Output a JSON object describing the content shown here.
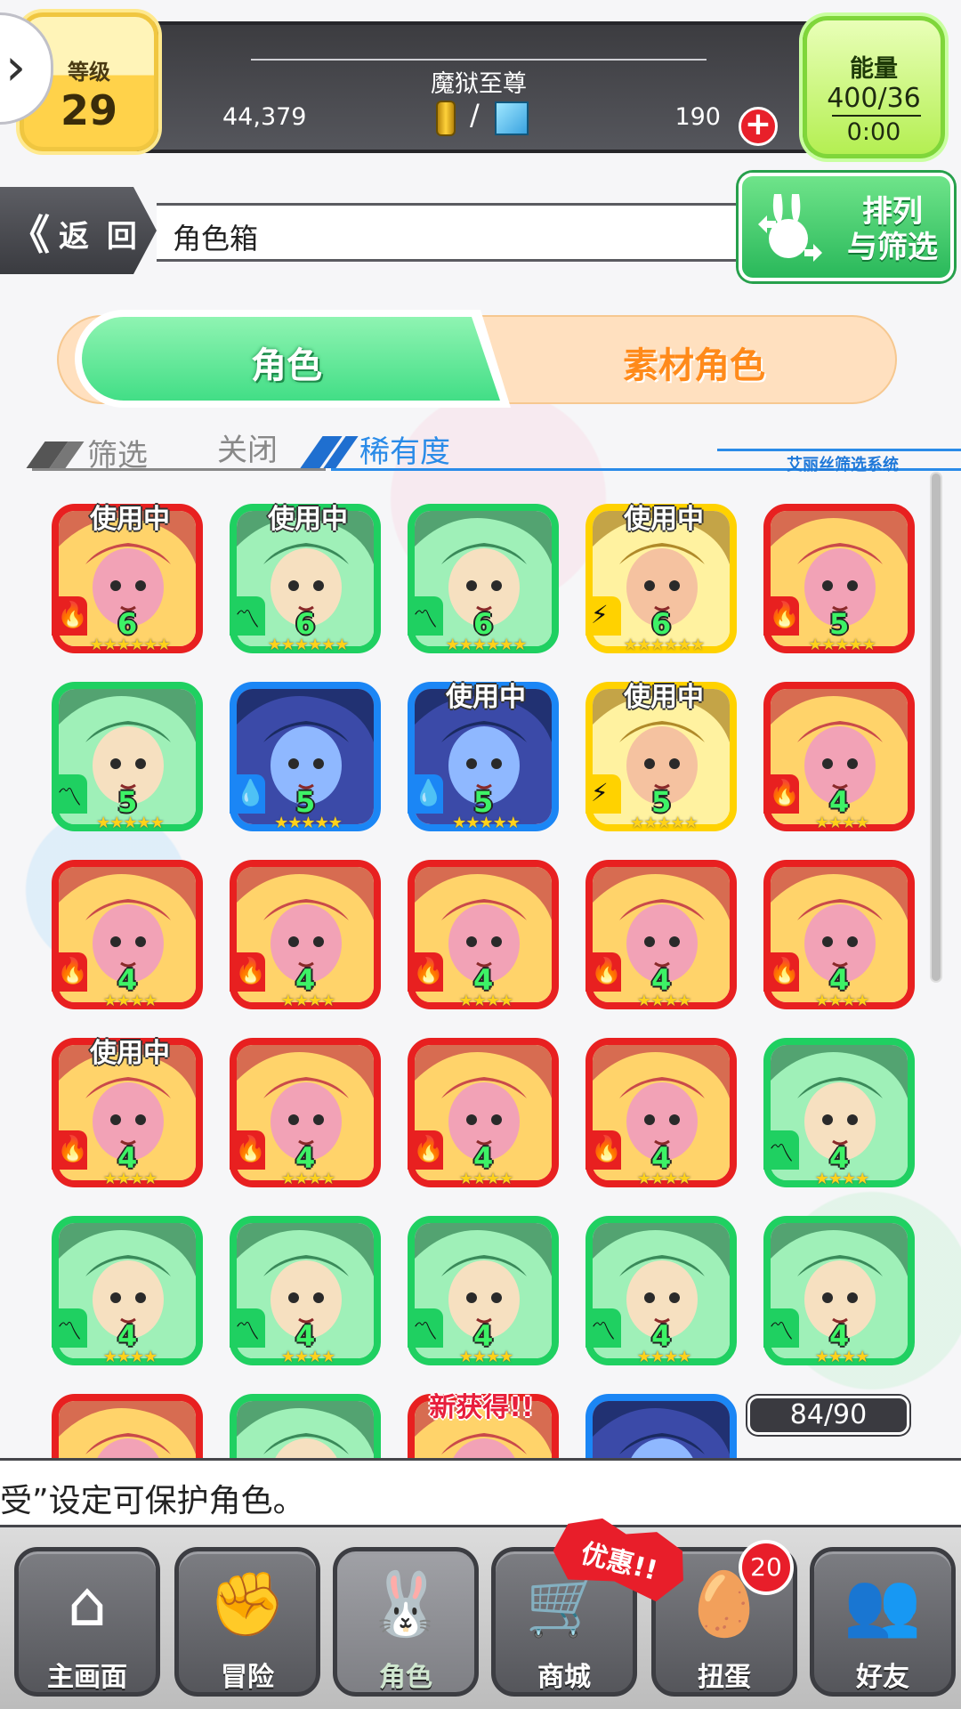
{
  "status_bar": {
    "level_label": "等级",
    "level_value": "29",
    "player_title": "魔狱至尊",
    "coins": "44,379",
    "crystals": "190",
    "currency_separator": "/",
    "plus_label": "+",
    "energy_label": "能量",
    "energy_value": "400/36",
    "energy_timer": "0:00"
  },
  "nav": {
    "back_label": "返 回",
    "back_chevron": "《",
    "breadcrumb": "角色箱",
    "sort_label_line1": "排列",
    "sort_label_line2": "与筛选"
  },
  "tabs": {
    "characters": "角色",
    "materials": "素材角色"
  },
  "filter": {
    "filter_label": "筛选",
    "filter_state": "关闭",
    "rarity_label": "稀有度",
    "system_label": "艾丽丝筛选系统"
  },
  "card_text": {
    "in_use": "使用中",
    "new_badge": "新获得!!",
    "stars_6": "★★★★★★",
    "stars_5": "★★★★★",
    "stars_4": "★★★★"
  },
  "element_icons": {
    "fire": "🔥",
    "wind": "〽",
    "water": "💧",
    "thunder": "⚡"
  },
  "colors": {
    "fire": "#e82020",
    "wind": "#1fd061",
    "water": "#1b86f5",
    "thunder": "#ffd200",
    "accent_green": "#42de86",
    "accent_orange": "#ff8a1a"
  },
  "characters": [
    {
      "element": "fire",
      "count": "6",
      "in_use": true
    },
    {
      "element": "wind",
      "count": "6",
      "in_use": true
    },
    {
      "element": "wind",
      "count": "6",
      "in_use": false
    },
    {
      "element": "thunder",
      "count": "6",
      "in_use": true
    },
    {
      "element": "fire",
      "count": "5",
      "in_use": false
    },
    {
      "element": "wind",
      "count": "5",
      "in_use": false
    },
    {
      "element": "water",
      "count": "5",
      "in_use": false
    },
    {
      "element": "water",
      "count": "5",
      "in_use": true
    },
    {
      "element": "thunder",
      "count": "5",
      "in_use": true
    },
    {
      "element": "fire",
      "count": "4",
      "in_use": false
    },
    {
      "element": "fire",
      "count": "4",
      "in_use": false
    },
    {
      "element": "fire",
      "count": "4",
      "in_use": false
    },
    {
      "element": "fire",
      "count": "4",
      "in_use": false
    },
    {
      "element": "fire",
      "count": "4",
      "in_use": false
    },
    {
      "element": "fire",
      "count": "4",
      "in_use": false
    },
    {
      "element": "fire",
      "count": "4",
      "in_use": true
    },
    {
      "element": "fire",
      "count": "4",
      "in_use": false
    },
    {
      "element": "fire",
      "count": "4",
      "in_use": false
    },
    {
      "element": "fire",
      "count": "4",
      "in_use": false
    },
    {
      "element": "wind",
      "count": "4",
      "in_use": false
    },
    {
      "element": "wind",
      "count": "4",
      "in_use": false
    },
    {
      "element": "wind",
      "count": "4",
      "in_use": false
    },
    {
      "element": "wind",
      "count": "4",
      "in_use": false
    },
    {
      "element": "wind",
      "count": "4",
      "in_use": false
    },
    {
      "element": "wind",
      "count": "4",
      "in_use": false
    },
    {
      "element": "fire",
      "count": "",
      "in_use": false
    },
    {
      "element": "wind",
      "count": "",
      "in_use": false
    },
    {
      "element": "fire",
      "count": "",
      "in_use": false,
      "new": true
    },
    {
      "element": "water",
      "count": "",
      "in_use": false
    }
  ],
  "box_capacity": "84/90",
  "ticker_text": "受”设定可保护角色。",
  "bottom_nav": [
    {
      "label": "主画面",
      "icon": "home-icon",
      "glyph": "⌂"
    },
    {
      "label": "冒险",
      "icon": "handshake-icon",
      "glyph": "✊"
    },
    {
      "label": "角色",
      "icon": "bunny-icon",
      "glyph": "🐰"
    },
    {
      "label": "商城",
      "icon": "cart-icon",
      "glyph": "🛒"
    },
    {
      "label": "扭蛋",
      "icon": "egg-icon",
      "glyph": "🥚"
    },
    {
      "label": "好友",
      "icon": "friends-icon",
      "glyph": "👥"
    }
  ],
  "promo_badge": "优惠!!",
  "gacha_badge_count": "20"
}
